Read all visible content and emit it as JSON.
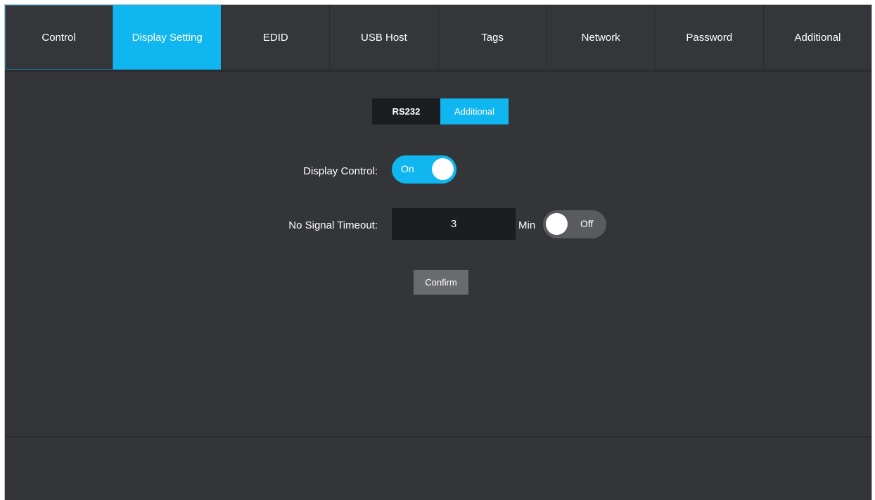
{
  "tabs": [
    {
      "label": "Control",
      "active": false
    },
    {
      "label": "Display Setting",
      "active": true
    },
    {
      "label": "EDID",
      "active": false
    },
    {
      "label": "USB Host",
      "active": false
    },
    {
      "label": "Tags",
      "active": false
    },
    {
      "label": "Network",
      "active": false
    },
    {
      "label": "Password",
      "active": false
    },
    {
      "label": "Additional",
      "active": false
    }
  ],
  "subtabs": {
    "rs232": "RS232",
    "additional": "Additional",
    "active": "additional"
  },
  "display_control": {
    "label": "Display Control:",
    "toggle_text": "On",
    "state": "on"
  },
  "no_signal_timeout": {
    "label": "No Signal Timeout:",
    "value": "3",
    "unit": "Min",
    "toggle_text": "Off",
    "state": "off"
  },
  "confirm_label": "Confirm",
  "colors": {
    "accent": "#0fb6ef",
    "panel": "#343539",
    "input_bg": "#1c1d20",
    "button_bg": "#6a6b6e"
  }
}
